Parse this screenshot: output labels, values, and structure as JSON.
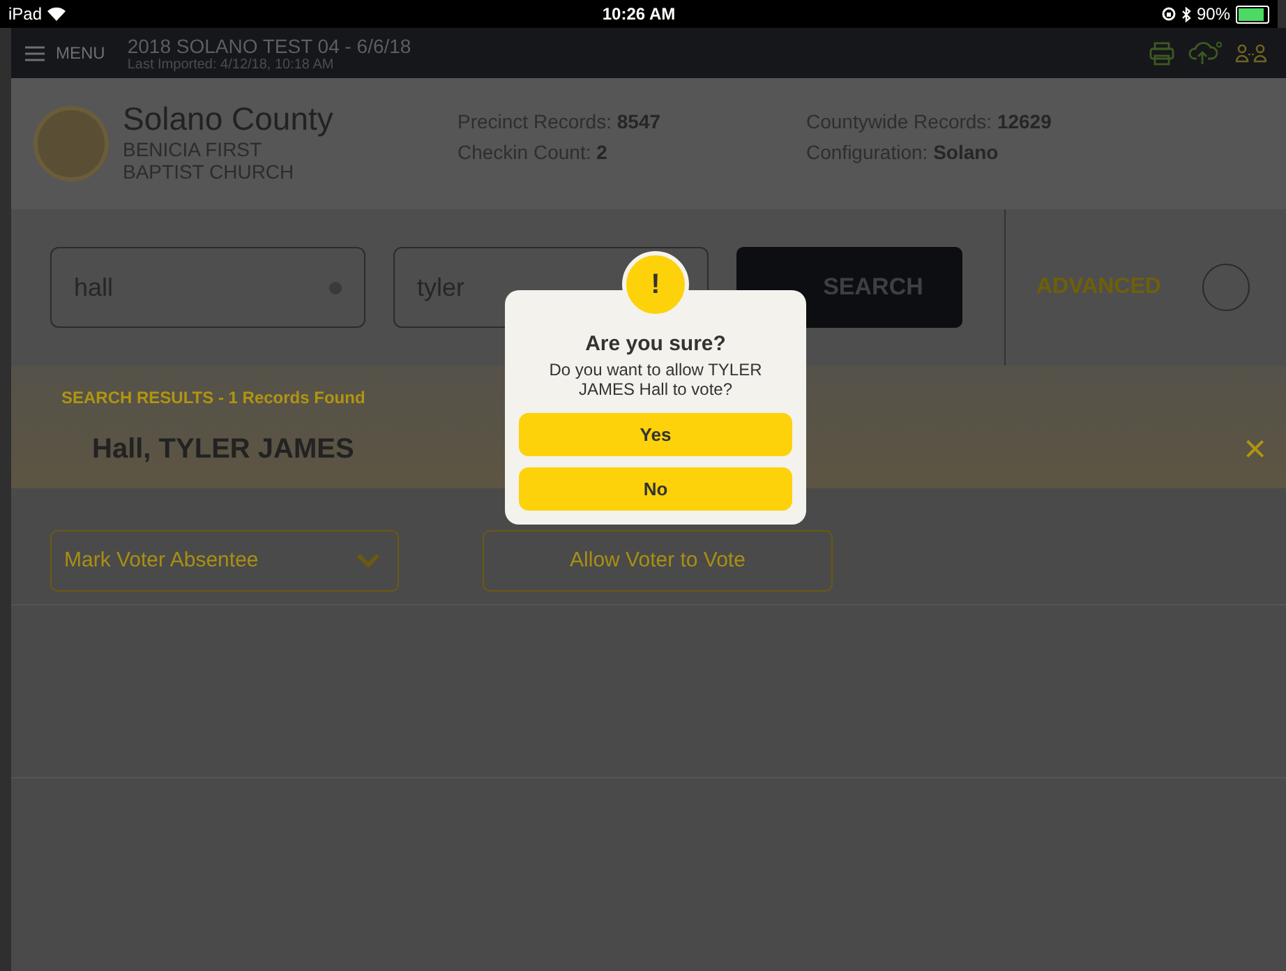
{
  "status_bar": {
    "carrier": "iPad",
    "time": "10:26 AM",
    "battery": "90%"
  },
  "nav_bar": {
    "menu": "MENU",
    "title": "2018 SOLANO TEST 04 - 6/6/18",
    "subtitle": "Last Imported: 4/12/18, 10:18 AM"
  },
  "header": {
    "county": "Solano County",
    "location": "BENICIA FIRST BAPTIST CHURCH",
    "stats": [
      {
        "label": "Precinct Records:",
        "value": "8547"
      },
      {
        "label": "Checkin Count:",
        "value": "2"
      },
      {
        "label": "Countywide Records:",
        "value": "12629"
      },
      {
        "label": "Configuration:",
        "value": "Solano"
      }
    ]
  },
  "search": {
    "last_name": "hall",
    "first_name": "tyler",
    "button": "SEARCH",
    "advanced": {
      "label": "ADVANCED",
      "on": false
    }
  },
  "results": {
    "summary": "SEARCH RESULTS - 1 Records Found",
    "voter_name": "Hall, TYLER JAMES",
    "close": "×"
  },
  "actions": {
    "dropdown": "Mark Voter Absentee",
    "button": "Allow Voter to Vote"
  },
  "dialog": {
    "icon": "!",
    "title": "Are you sure?",
    "message": "Do you want to allow TYLER JAMES Hall to vote?",
    "buttons": [
      "Yes",
      "No"
    ]
  }
}
